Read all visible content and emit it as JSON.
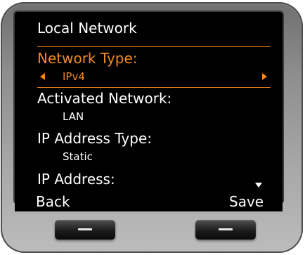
{
  "screen": {
    "title": "Local Network",
    "fields": [
      {
        "label": "Network Type:",
        "value": "IPv4"
      },
      {
        "label": "Activated Network:",
        "value": "LAN"
      },
      {
        "label": "IP Address Type:",
        "value": "Static"
      },
      {
        "label": "IP Address:"
      }
    ]
  },
  "softkeys": {
    "left": "Back",
    "right": "Save"
  },
  "colors": {
    "accent": "#f08a24",
    "screen_background": "#000000",
    "text": "#ffffff",
    "device_body": "#9a9a9a"
  },
  "icons": {
    "value_prev": "triangle-left-icon",
    "value_next": "triangle-right-icon",
    "scroll_more": "triangle-down-icon",
    "hardware_key": "dash-icon"
  }
}
